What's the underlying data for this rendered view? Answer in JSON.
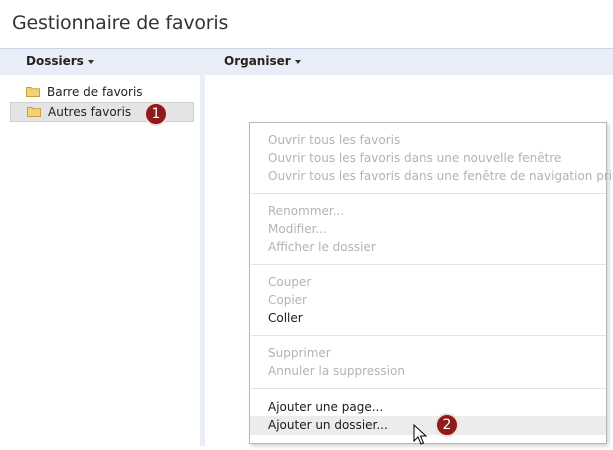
{
  "window": {
    "title": "Gestionnaire de favoris"
  },
  "toolbar": {
    "folders_label": "Dossiers",
    "organize_label": "Organiser"
  },
  "tree": {
    "items": [
      {
        "label": "Barre de favoris",
        "selected": false
      },
      {
        "label": "Autres favoris",
        "selected": true
      }
    ]
  },
  "menu": {
    "groups": [
      [
        {
          "label": "Ouvrir tous les favoris",
          "enabled": false
        },
        {
          "label": "Ouvrir tous les favoris dans une nouvelle fenêtre",
          "enabled": false
        },
        {
          "label": "Ouvrir tous les favoris dans une fenêtre de navigation privée",
          "enabled": false
        }
      ],
      [
        {
          "label": "Renommer...",
          "enabled": false
        },
        {
          "label": "Modifier...",
          "enabled": false
        },
        {
          "label": "Afficher le dossier",
          "enabled": false
        }
      ],
      [
        {
          "label": "Couper",
          "enabled": false
        },
        {
          "label": "Copier",
          "enabled": false
        },
        {
          "label": "Coller",
          "enabled": true
        }
      ],
      [
        {
          "label": "Supprimer",
          "enabled": false
        },
        {
          "label": "Annuler la suppression",
          "enabled": false
        }
      ],
      [
        {
          "label": "Ajouter une page...",
          "enabled": true
        },
        {
          "label": "Ajouter un dossier...",
          "enabled": true,
          "hovered": true
        }
      ]
    ]
  },
  "annotations": {
    "step1": "1",
    "step2": "2"
  },
  "colors": {
    "toolbar_bg": "#e9eef6",
    "badge_bg": "#8e1a1a",
    "disabled_text": "#b3b3b3",
    "folder_fill": "#f4d27a"
  },
  "icons": {
    "folder": "folder-icon",
    "caret": "caret-down-icon",
    "cursor": "mouse-cursor-icon"
  }
}
